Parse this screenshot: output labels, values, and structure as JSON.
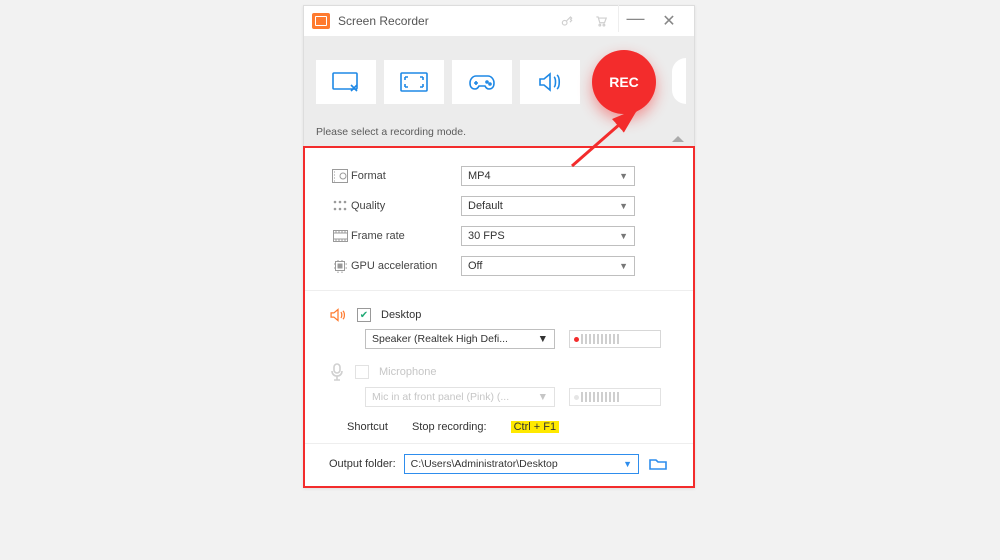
{
  "titlebar": {
    "title": "Screen Recorder"
  },
  "modebar": {
    "hint": "Please select a recording mode.",
    "rec_label": "REC"
  },
  "settings": {
    "format": {
      "label": "Format",
      "value": "MP4"
    },
    "quality": {
      "label": "Quality",
      "value": "Default"
    },
    "fps": {
      "label": "Frame rate",
      "value": "30 FPS"
    },
    "gpu": {
      "label": "GPU acceleration",
      "value": "Off"
    }
  },
  "audio": {
    "desktop": {
      "label": "Desktop",
      "checked": true,
      "device": "Speaker (Realtek High Defi..."
    },
    "mic": {
      "label": "Microphone",
      "checked": false,
      "device": "Mic in at front panel (Pink) (..."
    }
  },
  "shortcut": {
    "label": "Shortcut",
    "action": "Stop recording:",
    "keys": "Ctrl + F1"
  },
  "output": {
    "label": "Output folder:",
    "path": "C:\\Users\\Administrator\\Desktop"
  }
}
